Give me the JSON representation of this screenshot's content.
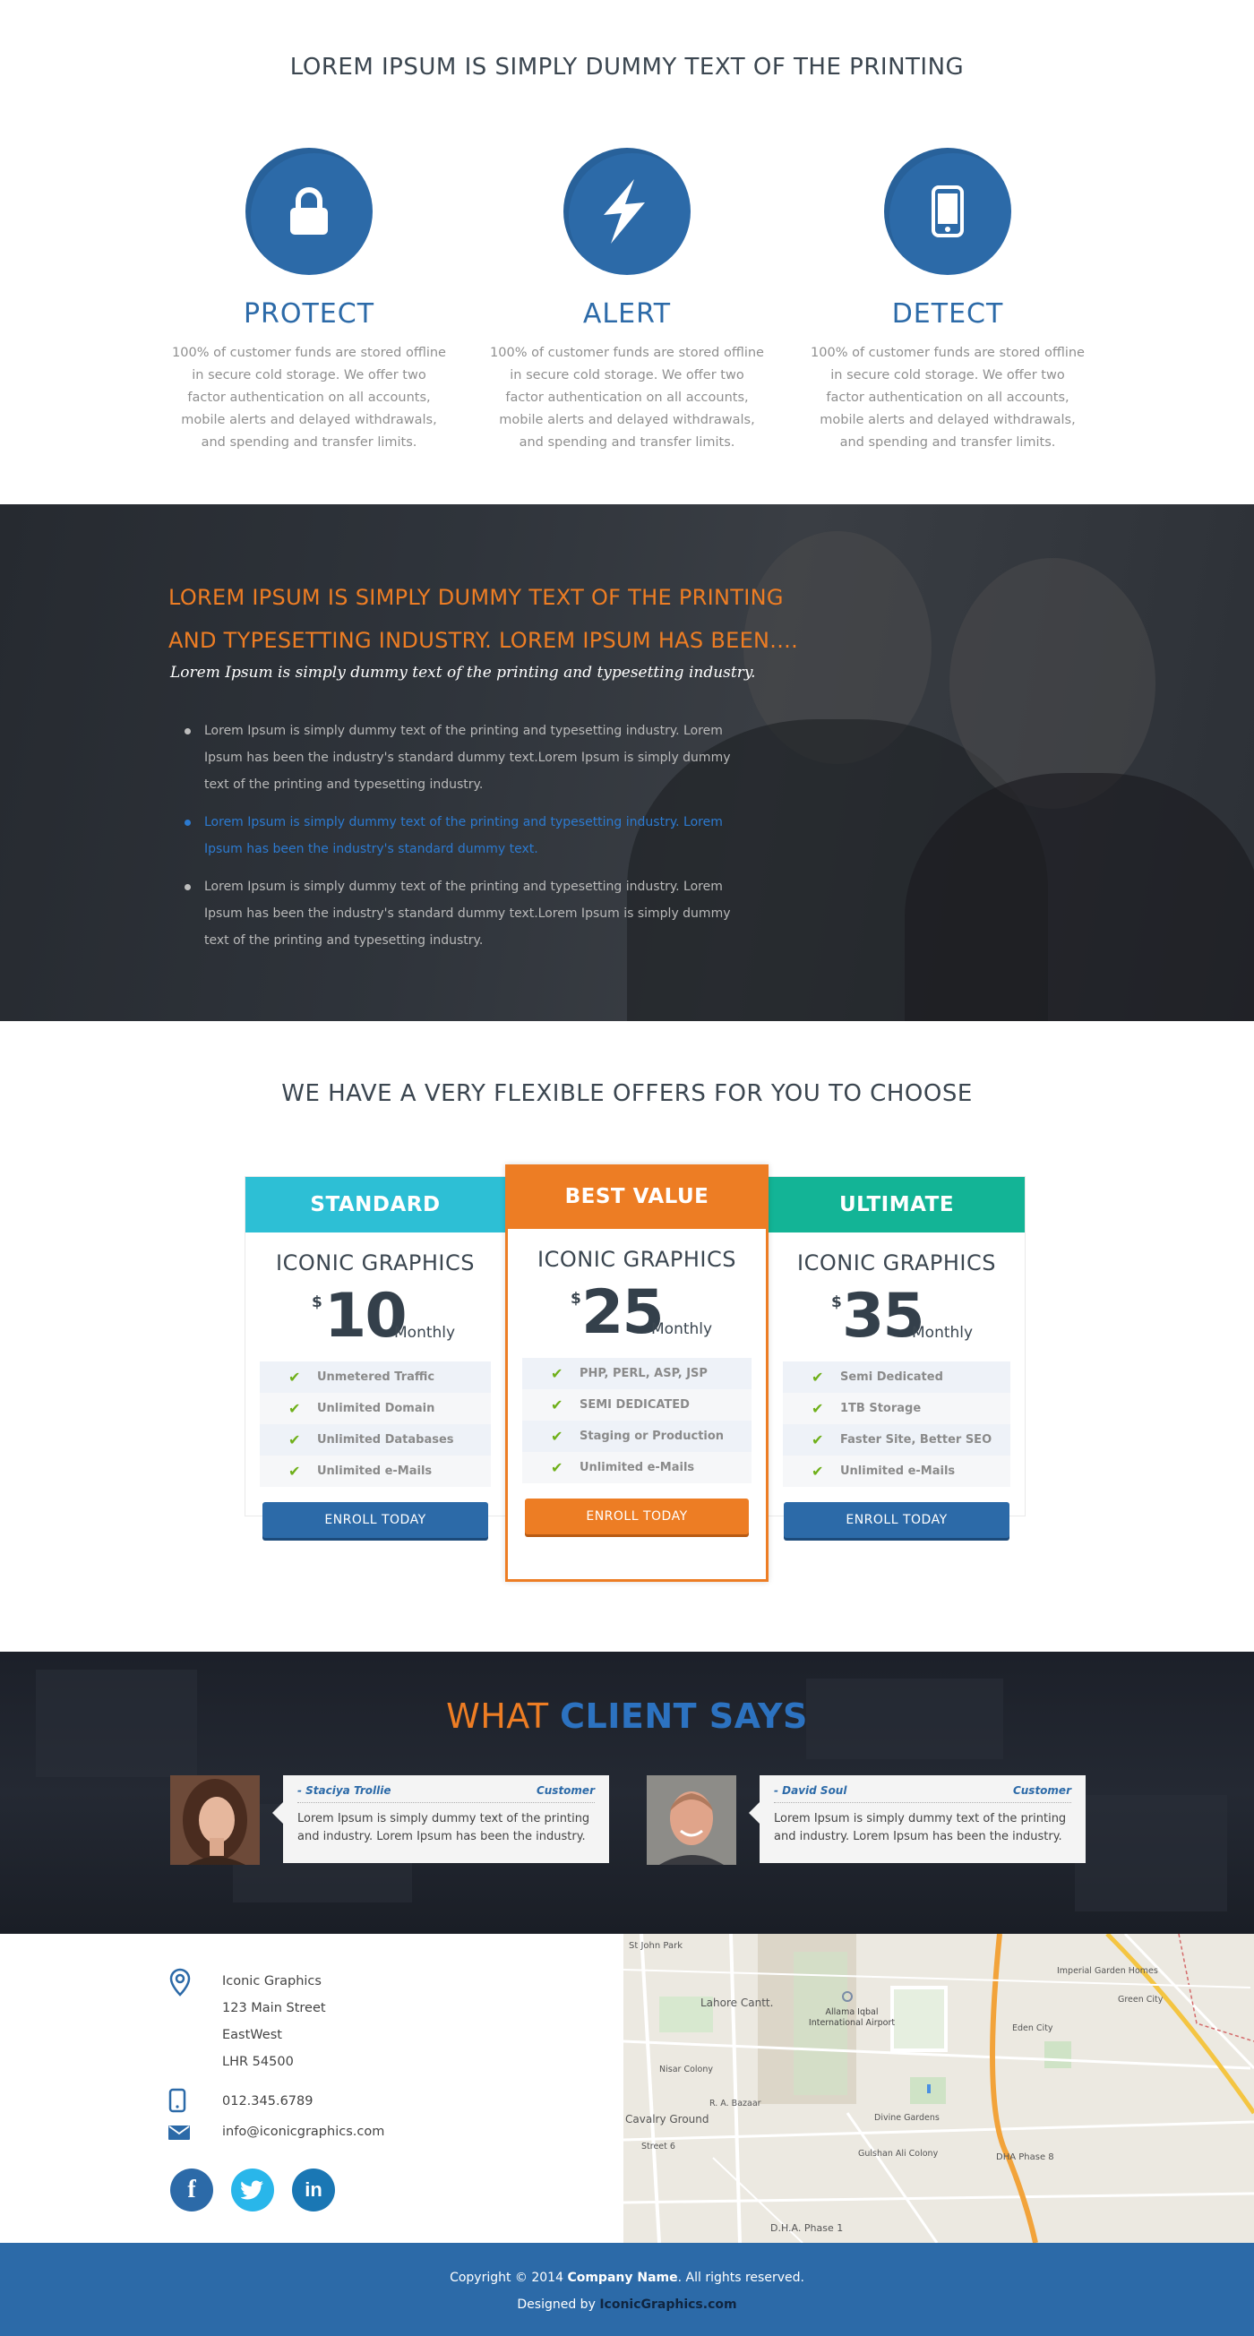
{
  "features": {
    "heading": "LOREM IPSUM IS SIMPLY DUMMY TEXT OF THE PRINTING",
    "items": [
      {
        "icon": "lock-icon",
        "title": "PROTECT",
        "text": "100% of customer funds are stored offline in secure cold storage. We offer two factor authentication on all accounts, mobile alerts and delayed withdrawals, and spending and transfer limits."
      },
      {
        "icon": "lightning-icon",
        "title": "ALERT",
        "text": "100% of customer funds are stored offline in secure cold storage. We offer two factor authentication on all accounts, mobile alerts and delayed withdrawals, and spending and transfer limits."
      },
      {
        "icon": "mobile-phone-icon",
        "title": "DETECT",
        "text": "100% of customer funds are stored offline in secure cold storage. We offer two factor authentication on all accounts, mobile alerts and delayed withdrawals, and spending and transfer limits."
      }
    ]
  },
  "banner": {
    "heading": "LOREM IPSUM IS SIMPLY DUMMY TEXT OF THE PRINTING AND TYPESETTING INDUSTRY. LOREM IPSUM HAS BEEN....",
    "subheading": "Lorem Ipsum is simply dummy text of the printing and typesetting industry.",
    "bullets": [
      "Lorem Ipsum is simply dummy text of the printing and typesetting industry. Lorem Ipsum has been the industry's standard dummy text.Lorem Ipsum is simply dummy text of the printing and typesetting industry.",
      "Lorem Ipsum is simply dummy text of the printing and typesetting industry. Lorem Ipsum has been the industry's standard dummy text.",
      "Lorem Ipsum is simply dummy text of the printing and typesetting industry. Lorem Ipsum has been the industry's standard dummy text.Lorem Ipsum is simply dummy text of the printing and typesetting industry."
    ]
  },
  "pricing": {
    "heading": "WE HAVE A VERY FLEXIBLE OFFERS FOR YOU TO CHOOSE",
    "plans": [
      {
        "name": "STANDARD",
        "brand": "ICONIC GRAPHICS",
        "currency": "$",
        "price": "10",
        "period": "Monthly",
        "features": [
          "Unmetered Traffic",
          "Unlimited Domain",
          "Unlimited Databases",
          "Unlimited e-Mails"
        ],
        "button": "ENROLL TODAY"
      },
      {
        "name": "BEST VALUE",
        "brand": "ICONIC GRAPHICS",
        "currency": "$",
        "price": "25",
        "period": "Monthly",
        "features": [
          "PHP, PERL, ASP, JSP",
          "SEMI DEDICATED",
          "Staging or Production",
          "Unlimited e-Mails"
        ],
        "button": "ENROLL TODAY"
      },
      {
        "name": "ULTIMATE",
        "brand": "ICONIC GRAPHICS",
        "currency": "$",
        "price": "35",
        "period": "Monthly",
        "features": [
          "Semi Dedicated",
          "1TB Storage",
          "Faster Site, Better SEO",
          "Unlimited e-Mails"
        ],
        "button": "ENROLL TODAY"
      }
    ],
    "colors": {
      "standard": "#2dbfd5",
      "best": "#ed7d24",
      "ultimate": "#13b496",
      "button_blue": "#2c6aa8"
    }
  },
  "testimonials": {
    "heading_a": "WHAT",
    "heading_b": "CLIENT SAYS",
    "items": [
      {
        "name": "- Staciya Trollie",
        "role": "Customer",
        "quote": "Lorem Ipsum is simply dummy text of the printing and industry. Lorem Ipsum has been the industry."
      },
      {
        "name": "- David Soul",
        "role": "Customer",
        "quote": "Lorem Ipsum is simply dummy text of the printing and industry. Lorem Ipsum has been the industry."
      }
    ]
  },
  "contact": {
    "address": [
      "Iconic Graphics",
      "123 Main Street",
      "EastWest",
      "LHR 54500"
    ],
    "phone": "012.345.6789",
    "email": "info@iconicgraphics.com",
    "social": [
      "facebook-icon",
      "twitter-icon",
      "linkedin-icon"
    ]
  },
  "map": {
    "labels": [
      "St John Park",
      "Lahore Cantt.",
      "Allama Iqbal International Airport",
      "Nisar Colony",
      "R. A. Bazaar",
      "Cavalry Ground",
      "Street 6",
      "Divine Gardens",
      "Gulshan Ali Colony",
      "DHA Phase 8",
      "D.H.A. Phase 1",
      "Eden City",
      "Green City",
      "Imperial Garden Homes"
    ]
  },
  "footer": {
    "copyright_pre": "Copyright © 2014",
    "company": "Company Name",
    "copyright_post": ". All rights reserved.",
    "designed_pre": "Designed by",
    "designer": "IconicGraphics.com"
  }
}
